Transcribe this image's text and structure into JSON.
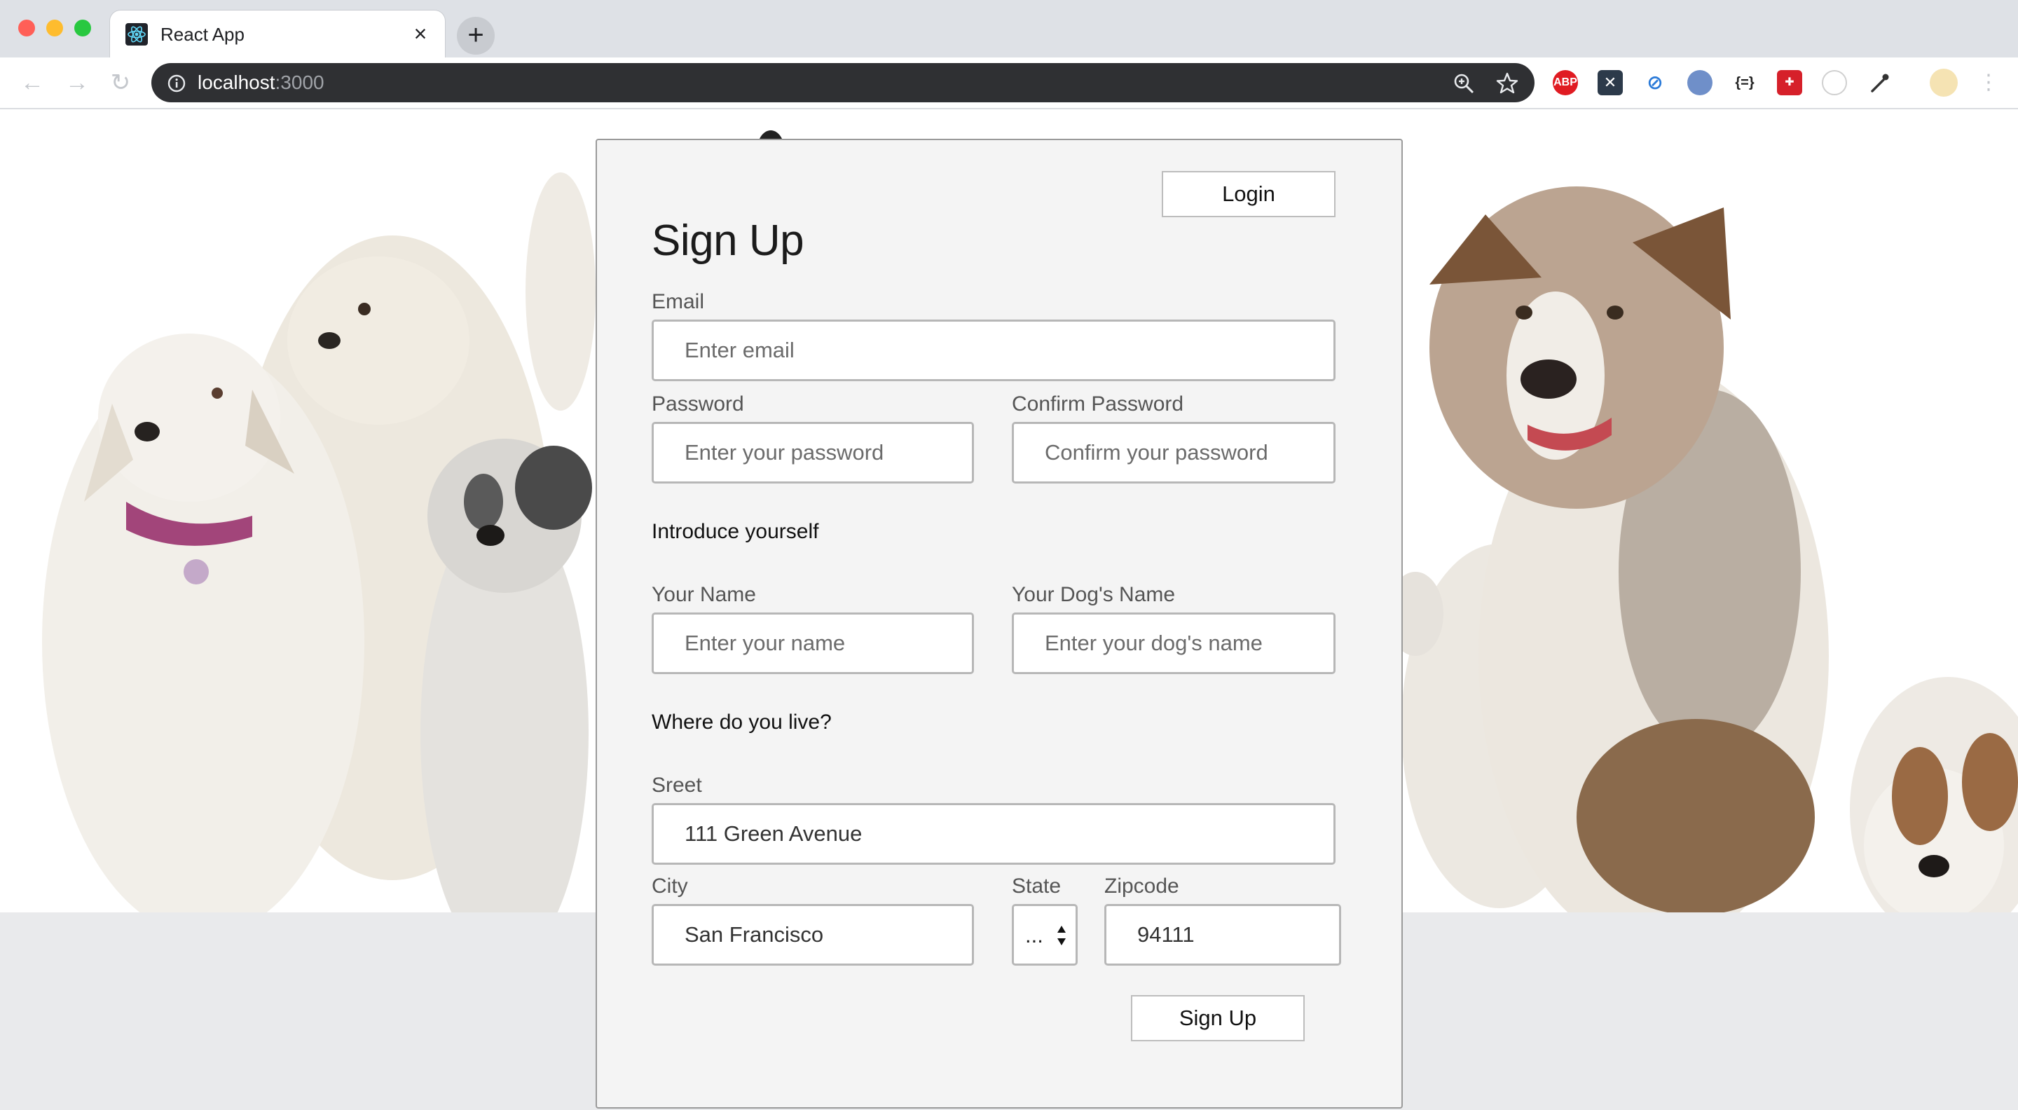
{
  "browser": {
    "tab_title": "React App",
    "url_host": "localhost",
    "url_port": ":3000",
    "extensions": [
      "abp-icon",
      "x-extension-icon",
      "compass-extension-icon",
      "feather-extension-icon",
      "json-viewer-icon",
      "puzzle-extension-icon",
      "cookie-extension-icon",
      "eyedropper-icon",
      "profile-avatar"
    ],
    "abp_label": "ABP",
    "json_label": "{=}"
  },
  "form": {
    "login_label": "Login",
    "title": "Sign Up",
    "email": {
      "label": "Email",
      "placeholder": "Enter email"
    },
    "password": {
      "label": "Password",
      "placeholder": "Enter your password"
    },
    "confirm_password": {
      "label": "Confirm Password",
      "placeholder": "Confirm your password"
    },
    "intro_heading": "Introduce yourself",
    "name": {
      "label": "Your Name",
      "placeholder": "Enter your name"
    },
    "dog_name": {
      "label": "Your Dog's Name",
      "placeholder": "Enter your dog's name"
    },
    "address_heading": "Where do you live?",
    "street": {
      "label": "Sreet",
      "value": "111 Green Avenue"
    },
    "city": {
      "label": "City",
      "value": "San Francisco"
    },
    "state": {
      "label": "State",
      "value": "..."
    },
    "zipcode": {
      "label": "Zipcode",
      "value": "94111"
    },
    "submit_label": "Sign Up"
  },
  "colors": {
    "card_bg": "#f4f4f4",
    "page_bg": "#e9eaec",
    "omnibox_bg": "#2f3033"
  }
}
